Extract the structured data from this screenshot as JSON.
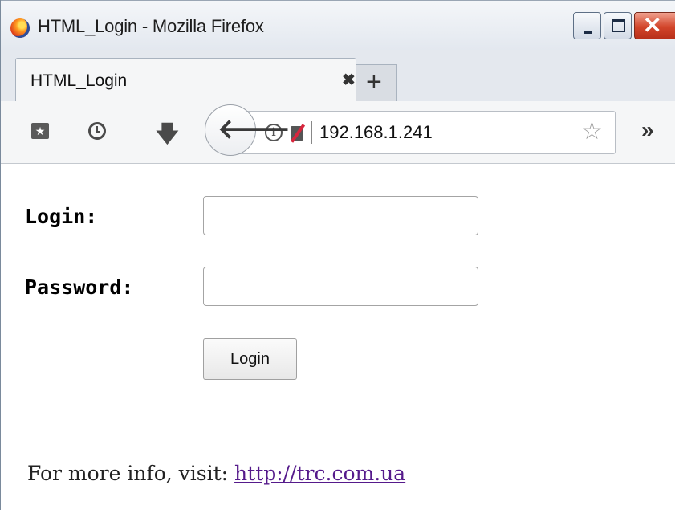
{
  "window": {
    "title": "HTML_Login - Mozilla Firefox",
    "app_icon": "firefox-icon",
    "controls": {
      "minimize": "minimize",
      "maximize": "maximize",
      "close": "✕"
    }
  },
  "tabs": [
    {
      "label": "HTML_Login",
      "close_symbol": "✖"
    }
  ],
  "new_tab_symbol": "+",
  "toolbar": {
    "back_symbol": "🡐",
    "url": "192.168.1.241",
    "info_symbol": "i",
    "bookmark_star": "☆",
    "overflow_symbol": "»",
    "download_symbol": "🡇"
  },
  "form": {
    "login_label": "Login:",
    "login_value": "",
    "password_label": "Password:",
    "password_value": "",
    "submit_label": "Login"
  },
  "footer": {
    "text": "For more info, visit: ",
    "link_text": "http://trc.com.ua"
  },
  "colors": {
    "link_visited": "#551a8b",
    "close_button": "#d2452a"
  }
}
